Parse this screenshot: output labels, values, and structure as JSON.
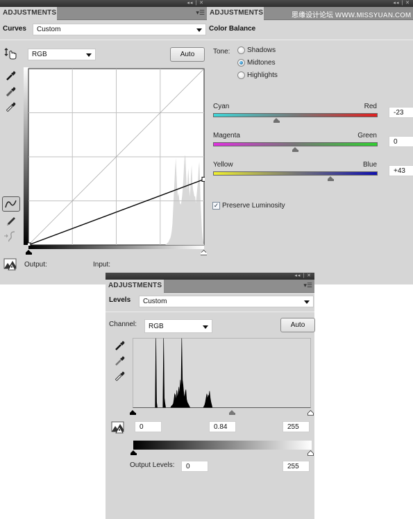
{
  "curves_panel": {
    "window_controls": "◂◂ | ✕",
    "tab_label": "ADJUSTMENTS",
    "menu_icon": "panel-menu-icon",
    "adjustment_type": "Curves",
    "preset_value": "Custom",
    "channel_value": "RGB",
    "auto_label": "Auto",
    "output_label": "Output:",
    "input_label": "Input:",
    "tools": [
      "on-image-adjust-icon",
      "black-point-eyedropper-icon",
      "gray-point-eyedropper-icon",
      "white-point-eyedropper-icon",
      "curve-points-icon",
      "pencil-icon",
      "smooth-icon",
      "clipping-warning-icon"
    ],
    "curve_points": [
      [
        0,
        0
      ],
      [
        255,
        95
      ]
    ],
    "input_range": [
      0,
      255
    ]
  },
  "color_balance_panel": {
    "tab_label": "ADJUSTMENTS",
    "adjustment_type": "Color Balance",
    "tone_label": "Tone:",
    "tones": [
      {
        "label": "Shadows",
        "selected": false
      },
      {
        "label": "Midtones",
        "selected": true
      },
      {
        "label": "Highlights",
        "selected": false
      }
    ],
    "sliders": [
      {
        "left": "Cyan",
        "right": "Red",
        "value": "-23",
        "numeric": -23,
        "left_color": "#3fd6d8",
        "right_color": "#e02020"
      },
      {
        "left": "Magenta",
        "right": "Green",
        "value": "0",
        "numeric": 0,
        "left_color": "#e030e0",
        "right_color": "#30d030"
      },
      {
        "left": "Yellow",
        "right": "Blue",
        "value": "+43",
        "numeric": 43,
        "left_color": "#f0f030",
        "right_color": "#1010b0"
      }
    ],
    "slider_range": [
      -100,
      100
    ],
    "preserve_luminosity_label": "Preserve Luminosity",
    "preserve_luminosity": true
  },
  "levels_panel": {
    "window_controls": "◂◂ | ✕",
    "tab_label": "ADJUSTMENTS",
    "adjustment_type": "Levels",
    "preset_value": "Custom",
    "channel_label": "Channel:",
    "channel_value": "RGB",
    "auto_label": "Auto",
    "input_black": "0",
    "input_gamma": "0.84",
    "input_white": "255",
    "output_levels_label": "Output Levels:",
    "output_black": "0",
    "output_white": "255"
  },
  "watermark": "思缘设计论坛 WWW.MISSYUAN.COM"
}
